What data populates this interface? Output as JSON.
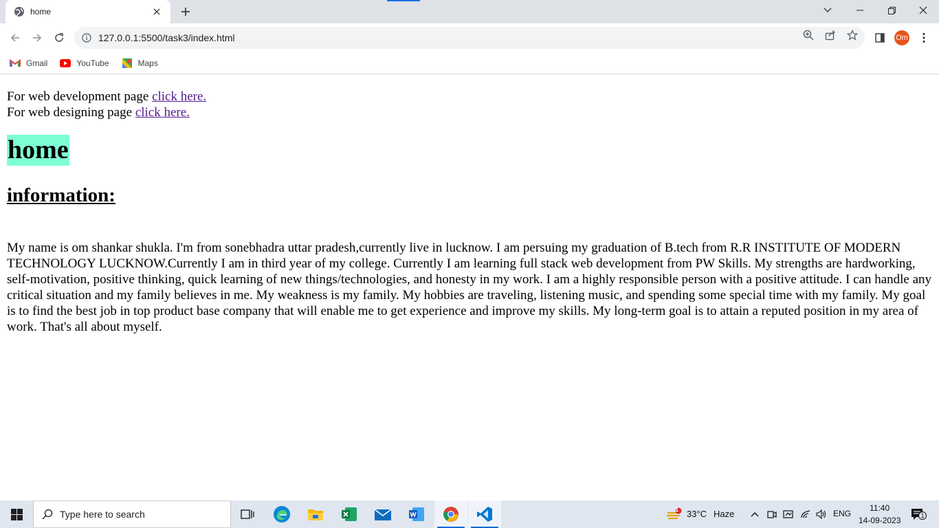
{
  "tab": {
    "title": "home",
    "close_icon": "close-icon",
    "new_tab_icon": "plus-icon"
  },
  "toolbar": {
    "url": "127.0.0.1:5500/task3/index.html",
    "profile_initials": "Om"
  },
  "bookmarks": [
    {
      "label": "Gmail",
      "icon": "gmail-icon"
    },
    {
      "label": "YouTube",
      "icon": "youtube-icon"
    },
    {
      "label": "Maps",
      "icon": "maps-icon"
    }
  ],
  "page": {
    "dev_line_text": "For web development page ",
    "dev_link": "click here.",
    "design_line_text": "For web designing page ",
    "design_link": "click here.",
    "heading": "home",
    "subheading": "information:",
    "paragraph": "My name is om shankar shukla. I'm from sonebhadra uttar pradesh,currently live in lucknow. I am persuing my graduation of B.tech from R.R INSTITUTE OF MODERN TECHNOLOGY LUCKNOW.Currently I am in third year of my college. Currently I am learning full stack web development from PW Skills. My strengths are hardworking, self-motivation, positive thinking, quick learning of new things/technologies, and honesty in my work. I am a highly responsible person with a positive attitude. I can handle any critical situation and my family believes in me. My weakness is my family. My hobbies are traveling, listening music, and spending some special time with my family. My goal is to find the best job in top product base company that will enable me to get experience and improve my skills. My long-term goal is to attain a reputed position in my area of work. That's all about myself.",
    "heading_bg": "#7fffd4",
    "link_color": "#551a8b"
  },
  "taskbar": {
    "search_placeholder": "Type here to search",
    "weather_temp": "33°C",
    "weather_desc": "Haze",
    "weather_badge": "1",
    "language": "ENG",
    "time": "11:40",
    "date": "14-09-2023",
    "notification_count": "1"
  }
}
